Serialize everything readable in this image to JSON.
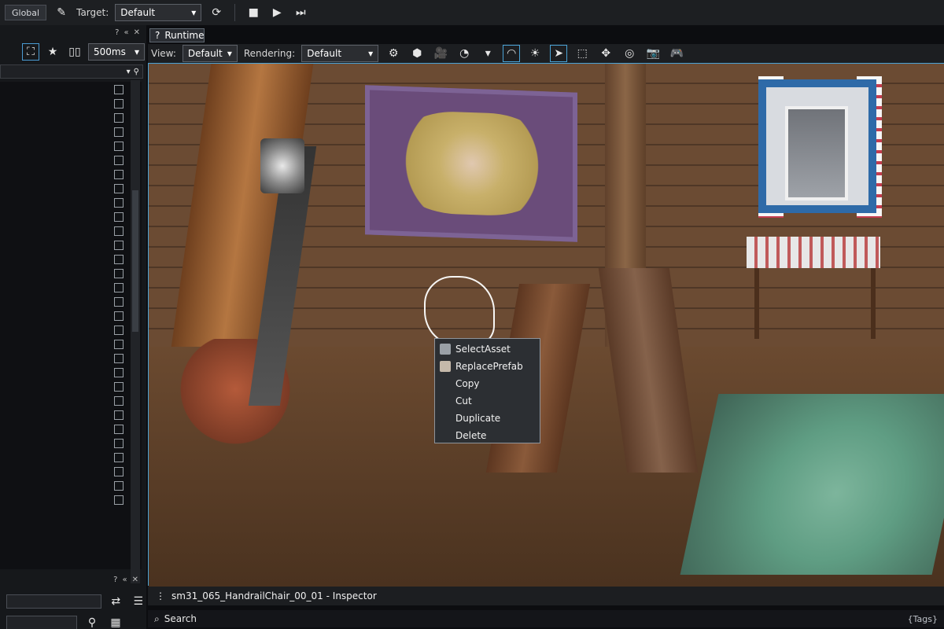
{
  "topbar": {
    "global_label": "Global",
    "target_label": "Target:",
    "target_value": "Default"
  },
  "left_panel": {
    "interval_value": "500ms"
  },
  "runtime": {
    "tab_label": "Runtime"
  },
  "viewbar": {
    "view_label": "View:",
    "view_value": "Default",
    "rendering_label": "Rendering:",
    "rendering_value": "Default"
  },
  "context_menu": {
    "items": [
      {
        "label": "SelectAsset"
      },
      {
        "label": "ReplacePrefab"
      },
      {
        "label": "Copy"
      },
      {
        "label": "Cut"
      },
      {
        "label": "Duplicate"
      },
      {
        "label": "Delete"
      }
    ]
  },
  "inspector": {
    "title": "sm31_065_HandrailChair_00_01 - Inspector",
    "search_label": "Search",
    "tags_label": "{Tags}"
  },
  "icons": {
    "gear": "gear-icon",
    "cube": "cube-icon",
    "camera": "camera-icon",
    "play": "play-icon",
    "step": "step-icon",
    "stop": "stop-icon",
    "refresh": "refresh-icon",
    "filter": "filter-icon",
    "pointer": "pointer-icon",
    "select": "select-icon",
    "sun": "sun-icon",
    "grid": "grid-icon",
    "star": "star-icon",
    "search": "search-icon"
  }
}
